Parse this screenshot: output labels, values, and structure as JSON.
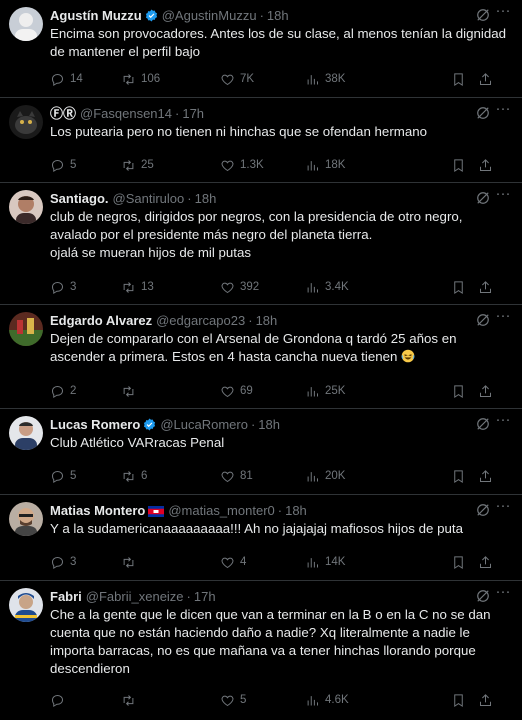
{
  "posts": [
    {
      "name": "Agustín Muzzu",
      "verified": true,
      "handle": "@AgustinMuzzu",
      "time": "18h",
      "text": "Encima son provocadores. Antes los de su clase, al menos tenían la dignidad de mantener el perfil bajo",
      "replies": "14",
      "reposts": "106",
      "likes": "7K",
      "views": "38K",
      "avatar_color": "#9aa6b2"
    },
    {
      "name": "ⒻⓇ",
      "verified": false,
      "handle": "@Fasqensen14",
      "time": "17h",
      "text": "Los putearia pero no tienen ni hinchas que se ofendan hermano",
      "replies": "5",
      "reposts": "25",
      "likes": "1.3K",
      "views": "18K",
      "avatar_color": "#2a2a2a"
    },
    {
      "name": "Santiago.",
      "verified": false,
      "handle": "@Santiruloo",
      "time": "18h",
      "text": "club de negros, dirigidos por negros, con la presidencia de otro negro,\navalado por el presidente más negro del planeta tierra.\nojalá se mueran hijos de mil putas",
      "replies": "3",
      "reposts": "13",
      "likes": "392",
      "views": "3.4K",
      "avatar_color": "#a67c6d"
    },
    {
      "name": "Edgardo Alvarez",
      "verified": false,
      "handle": "@edgarcapo23",
      "time": "18h",
      "text": "Dejen de compararlo con el  Arsenal de Grondona q tardó 25 años en ascender a primera. Estos en 4 hasta cancha nueva tienen",
      "replies": "2",
      "reposts": "",
      "likes": "69",
      "views": "25K",
      "avatar_color": "#7a3b2e"
    },
    {
      "name": "Lucas Romero",
      "verified": true,
      "handle": "@LucaRomero",
      "time": "18h",
      "text": "Club Atlético VARracas Penal",
      "replies": "5",
      "reposts": "6",
      "likes": "81",
      "views": "20K",
      "avatar_color": "#c9ccd1"
    },
    {
      "name": "Matias Montero",
      "verified": false,
      "handle": "@matias_monter0",
      "time": "18h",
      "text": "Y a la sudamericanaaaaaaaaa!!! Ah no jajajajaj mafiosos hijos de puta",
      "replies": "3",
      "reposts": "",
      "likes": "4",
      "views": "14K",
      "avatar_color": "#8c7a6b"
    },
    {
      "name": "Fabri",
      "verified": false,
      "handle": "@Fabrii_xeneize",
      "time": "17h",
      "text": "Che a la gente que le dicen que van a terminar en la B o en la C no se dan cuenta que no están haciendo daño a nadie? Xq literalmente a nadie le importa barracas, no es que mañana va a tener hinchas llorando porque descendieron",
      "replies": "",
      "reposts": "",
      "likes": "5",
      "views": "4.6K",
      "avatar_color": "#4a6fa5"
    }
  ],
  "accent": "#1d9bf0",
  "muted_color": "#71767b",
  "icons": [
    "verified-badge-icon",
    "grok-icon",
    "more-icon",
    "reply-icon",
    "retweet-icon",
    "like-icon",
    "views-icon",
    "bookmark-icon",
    "share-icon",
    "laughing-emoji-icon",
    "cambodia-flag-icon"
  ]
}
